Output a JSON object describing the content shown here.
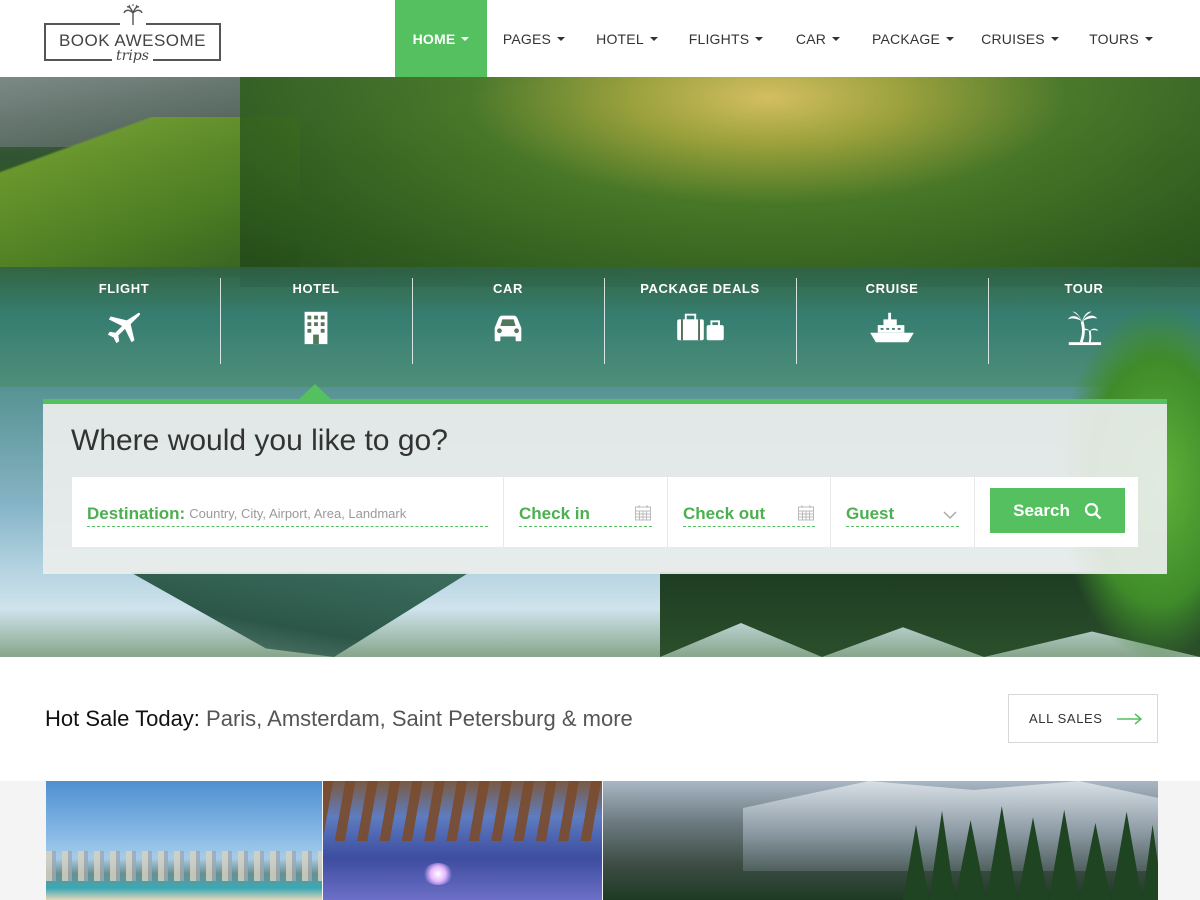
{
  "brand": {
    "name": "BOOK AWESOME",
    "tagline": "trips"
  },
  "nav": {
    "items": [
      {
        "label": "HOME",
        "active": true
      },
      {
        "label": "PAGES"
      },
      {
        "label": "HOTEL"
      },
      {
        "label": "FLIGHTS"
      },
      {
        "label": "CAR"
      },
      {
        "label": "PACKAGE"
      },
      {
        "label": "CRUISES"
      },
      {
        "label": "TOURS"
      }
    ]
  },
  "categories": [
    {
      "label": "FLIGHT",
      "icon": "airplane-icon"
    },
    {
      "label": "HOTEL",
      "icon": "hotel-building-icon",
      "selected": true
    },
    {
      "label": "CAR",
      "icon": "car-icon"
    },
    {
      "label": "PACKAGE DEALS",
      "icon": "luggage-icon"
    },
    {
      "label": "CRUISE",
      "icon": "cruise-ship-icon"
    },
    {
      "label": "TOUR",
      "icon": "palm-tree-icon"
    }
  ],
  "search": {
    "title": "Where would you like to go?",
    "destination_label": "Destination:",
    "destination_placeholder": "Country, City, Airport, Area, Landmark",
    "checkin_label": "Check in",
    "checkout_label": "Check out",
    "guest_label": "Guest",
    "button_label": "Search"
  },
  "hot_sale": {
    "label": "Hot Sale Today:",
    "cities": "Paris, Amsterdam, Saint Petersburg & more",
    "all_sales_label": "ALL SALES"
  },
  "colors": {
    "accent": "#54c060",
    "text": "#333333"
  }
}
